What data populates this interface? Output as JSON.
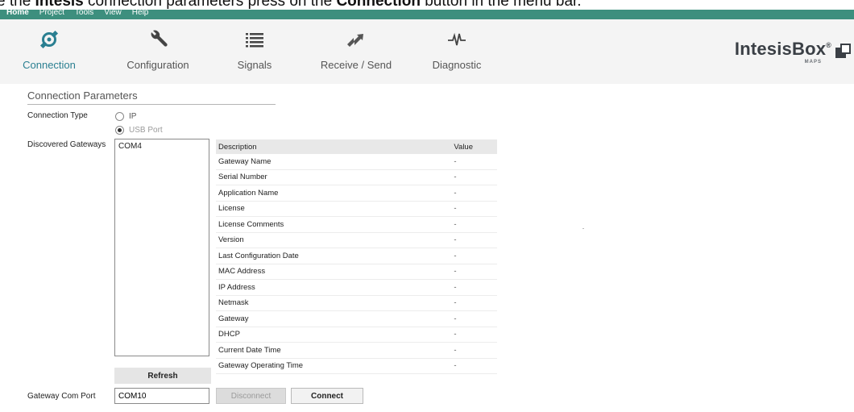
{
  "caption": {
    "prefix": "e the ",
    "bold1": "Intesis",
    "middle": " connection parameters press on the ",
    "bold2": "Connection",
    "suffix": " button in the menu bar."
  },
  "menubar": {
    "items": [
      "Home",
      "Project",
      "Tools",
      "View",
      "Help"
    ],
    "active": "Home"
  },
  "toolbar": {
    "tools": [
      {
        "label": "Connection",
        "icon": "connection-icon",
        "selected": true
      },
      {
        "label": "Configuration",
        "icon": "wrench-icon",
        "selected": false
      },
      {
        "label": "Signals",
        "icon": "list-icon",
        "selected": false
      },
      {
        "label": "Receive / Send",
        "icon": "transfer-icon",
        "selected": false
      },
      {
        "label": "Diagnostic",
        "icon": "pulse-icon",
        "selected": false
      }
    ],
    "accent_color": "#2a7f91"
  },
  "brand": {
    "name": "IntesisBox",
    "reg": "®",
    "sub": "MAPS"
  },
  "connection": {
    "section_title": "Connection Parameters",
    "connection_type_label": "Connection Type",
    "options": [
      {
        "label": "IP",
        "selected": false
      },
      {
        "label": "USB Port",
        "selected": true
      }
    ],
    "discovered_label": "Discovered Gateways",
    "gateways": [
      "COM4"
    ],
    "table": {
      "headers": [
        "Description",
        "Value"
      ],
      "rows": [
        [
          "Gateway Name",
          "-"
        ],
        [
          "Serial Number",
          "-"
        ],
        [
          "Application Name",
          "-"
        ],
        [
          "License",
          "-"
        ],
        [
          "License Comments",
          "-"
        ],
        [
          "Version",
          "-"
        ],
        [
          "Last Configuration Date",
          "-"
        ],
        [
          "MAC Address",
          "-"
        ],
        [
          "IP Address",
          "-"
        ],
        [
          "Netmask",
          "-"
        ],
        [
          "Gateway",
          "-"
        ],
        [
          "DHCP",
          "-"
        ],
        [
          "Current Date Time",
          "-"
        ],
        [
          "Gateway Operating Time",
          "-"
        ]
      ]
    },
    "refresh_label": "Refresh",
    "com_port_label": "Gateway Com Port",
    "com_port_value": "COM10",
    "disconnect_label": "Disconnect",
    "connect_label": "Connect"
  },
  "colors": {
    "menubar": "#3d8f7e",
    "toolbar_bg": "#f4f4f4"
  }
}
